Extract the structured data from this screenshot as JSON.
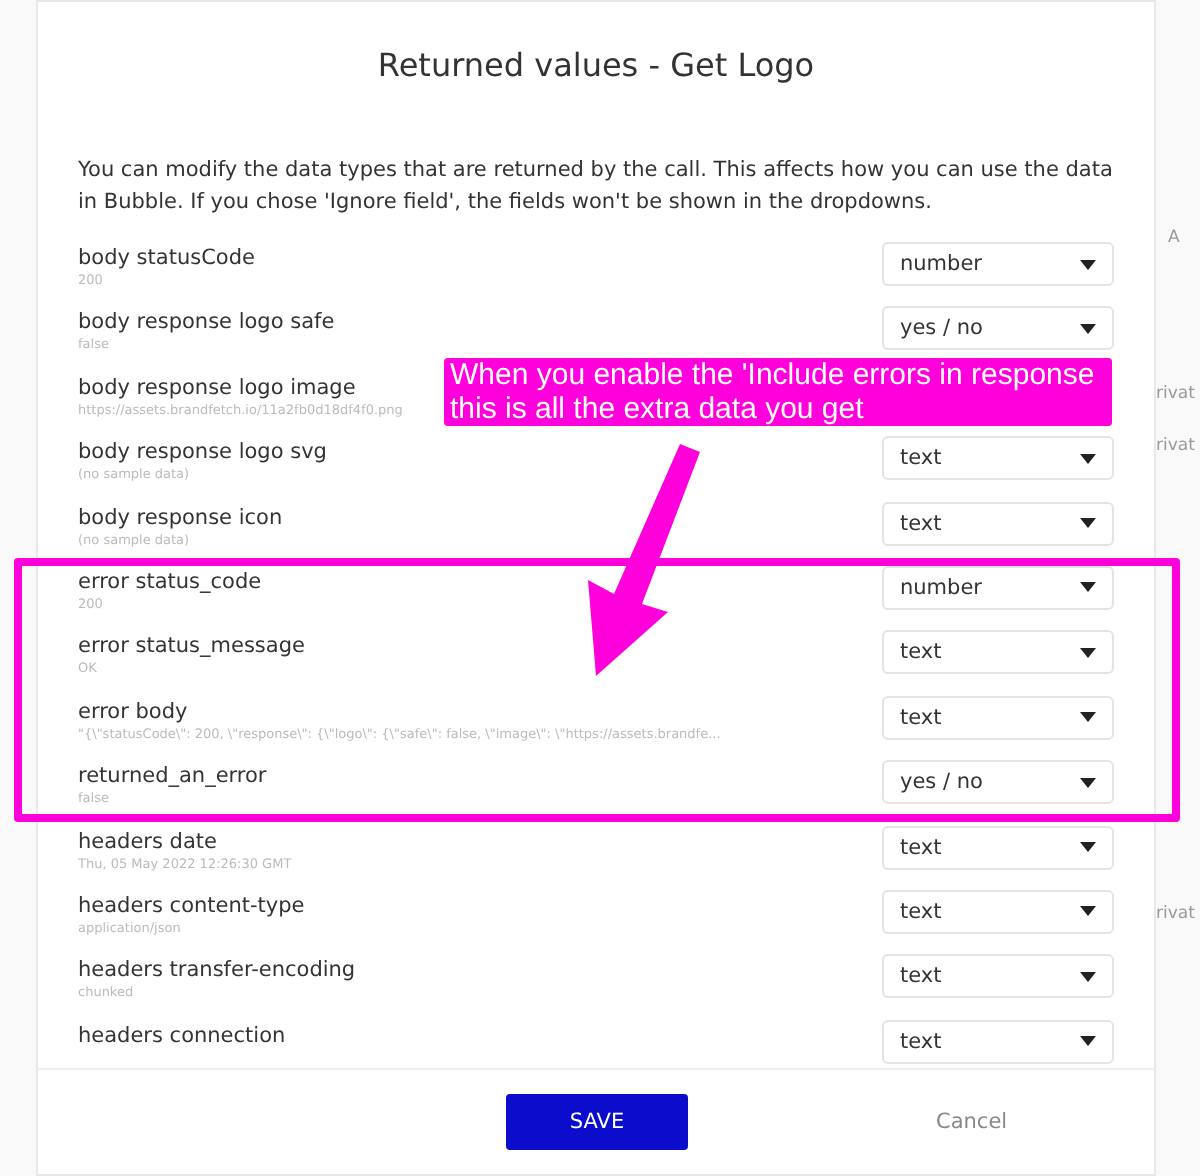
{
  "dialog": {
    "title": "Returned values - Get Logo",
    "description": "You can modify the data types that are returned by the call. This affects how you can use the data in Bubble. If you chose 'Ignore field', the fields won't be shown in the dropdowns."
  },
  "rows": [
    {
      "name": "body statusCode",
      "sample": "200",
      "type": "number"
    },
    {
      "name": "body response logo safe",
      "sample": "false",
      "type": "yes / no"
    },
    {
      "name": "body response logo image",
      "sample": "https://assets.brandfetch.io/11a2fb0d18df4f0.png"
    },
    {
      "name": "body response logo svg",
      "sample": "(no sample data)",
      "type": "text"
    },
    {
      "name": "body response icon",
      "sample": "(no sample data)",
      "type": "text"
    },
    {
      "name": "error status_code",
      "sample": "200",
      "type": "number"
    },
    {
      "name": "error status_message",
      "sample": "OK",
      "type": "text"
    },
    {
      "name": "error body",
      "sample": "\"{\\\"statusCode\\\": 200, \\\"response\\\": {\\\"logo\\\": {\\\"safe\\\": false, \\\"image\\\": \\\"https://assets.brandfe...",
      "type": "text"
    },
    {
      "name": "returned_an_error",
      "sample": "false",
      "type": "yes / no"
    },
    {
      "name": "headers date",
      "sample": "Thu, 05 May 2022 12:26:30 GMT",
      "type": "text"
    },
    {
      "name": "headers content-type",
      "sample": "application/json",
      "type": "text"
    },
    {
      "name": "headers transfer-encoding",
      "sample": "chunked",
      "type": "text"
    },
    {
      "name": "headers connection",
      "type": "text"
    }
  ],
  "buttons": {
    "save": "SAVE",
    "cancel": "Cancel"
  },
  "annotation": {
    "text": "When you enable the 'Include errors in response\nthis is all the extra data you get"
  },
  "background_fragments": [
    "A",
    "rivat",
    "rivat",
    "rivat"
  ]
}
